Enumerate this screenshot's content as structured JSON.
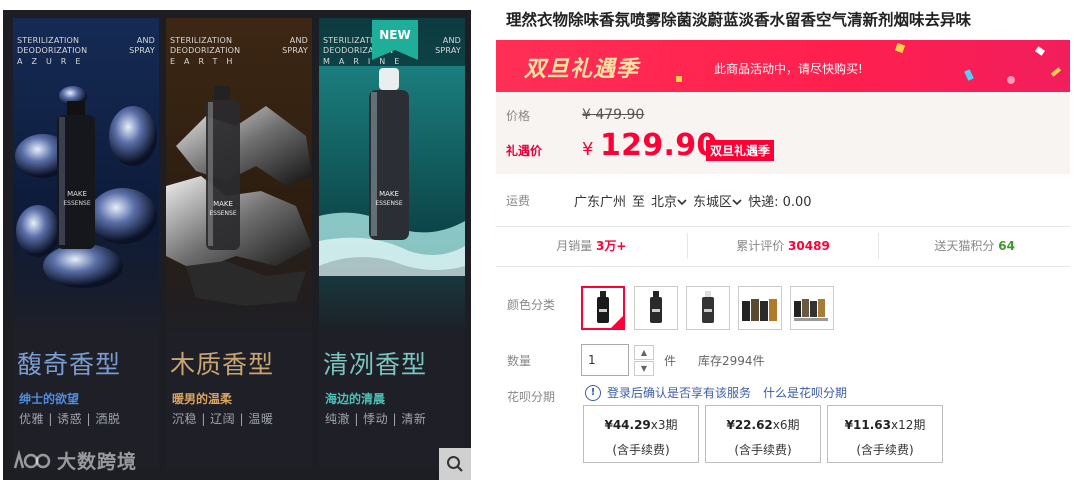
{
  "banner": {
    "new_badge": "NEW",
    "watermark": "大数跨境",
    "panels": [
      {
        "line1_left": "STERILIZATION",
        "line1_right": "AND",
        "line2_left": "DEODORIZATION",
        "line2_right": "SPRAY",
        "spaced": "AZURE",
        "bottle_label": "MAKE ESSENSE",
        "title": "馥奇香型",
        "subtitle": "绅士的欲望",
        "tags": "优雅 | 诱惑 | 洒脱"
      },
      {
        "line1_left": "STERILIZATION",
        "line1_right": "AND",
        "line2_left": "DEODORIZATION",
        "line2_right": "SPRAY",
        "spaced": "EARTH",
        "bottle_label": "MAKE ESSENSE",
        "title": "木质香型",
        "subtitle": "暖男的温柔",
        "tags": "沉稳 | 辽阔 | 温暖"
      },
      {
        "line1_left": "STERILIZATION",
        "line1_right": "AND",
        "line2_left": "DEODORIZATION",
        "line2_right": "SPRAY",
        "spaced": "MARINE",
        "bottle_label": "MAKE ESSENSE",
        "title": "清冽香型",
        "subtitle": "海边的清晨",
        "tags": "纯澈 | 悸动 | 清新"
      }
    ]
  },
  "product": {
    "title": "理然衣物除味香氛喷雾除菌淡蔚蓝淡香水留香空气清新剂烟味去异味",
    "promo_logo": "双旦礼遇季",
    "promo_message": "此商品活动中，请尽快购买!",
    "price_label": "价格",
    "original_price": "¥ 479.90",
    "deal_label": "礼遇价",
    "currency": "¥",
    "current_price": "129.90",
    "price_tag": "双旦礼遇季",
    "shipping_label": "运费",
    "ship_from": "广东广州",
    "ship_to_word": "至",
    "ship_city": "北京",
    "ship_district": "东城区",
    "ship_fee": "快递: 0.00",
    "stats": {
      "monthly_label": "月销量",
      "monthly_value": "3万+",
      "reviews_label": "累计评价",
      "reviews_value": "30489",
      "points_label": "送天猫积分",
      "points_value": "64"
    },
    "color_label": "颜色分类",
    "quantity_label": "数量",
    "quantity_value": "1",
    "quantity_unit": "件",
    "stock": "库存2994件",
    "huabei_label": "花呗分期",
    "huabei_info": "登录后确认是否享有该服务",
    "huabei_link": "什么是花呗分期",
    "plans": [
      {
        "price": "¥44.29",
        "term": "x3期",
        "fee": "(含手续费)"
      },
      {
        "price": "¥22.62",
        "term": "x6期",
        "fee": "(含手续费)"
      },
      {
        "price": "¥11.63",
        "term": "x12期",
        "fee": "(含手续费)"
      }
    ]
  },
  "colors": {
    "accent": "#ff0036",
    "link": "#3d5da7",
    "green": "#3e9a2c"
  }
}
